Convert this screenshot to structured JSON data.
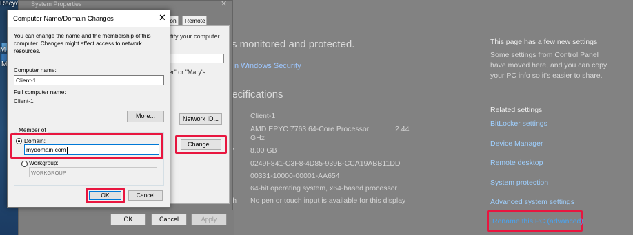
{
  "desktop": {
    "recycle_label": "Recycle",
    "icon_label_m": "M",
    "icon_label_m2": "M"
  },
  "settings": {
    "protection_heading": "s monitored and protected.",
    "windows_security_link": "n Windows Security",
    "specs_heading": "pecifications",
    "spec_fragment_memory": "M",
    "spec_fragment_pen": "ch",
    "specs": [
      {
        "value": "Client-1"
      },
      {
        "value": "AMD EPYC 7763 64-Core Processor",
        "extra": "2.44",
        "extra2": "GHz"
      },
      {
        "value": "8.00 GB"
      },
      {
        "value": "0249F841-C3F8-4D85-939B-CCA19ABB11DD"
      },
      {
        "value": "00331-10000-00001-AA654"
      },
      {
        "value": "64-bit operating system, x64-based processor"
      },
      {
        "value": "No pen or touch input is available for this display"
      }
    ],
    "new_settings_title": "This page has a few new settings",
    "new_settings_text": "Some settings from Control Panel have moved here, and you can copy your PC info so it's easier to share.",
    "related_title": "Related settings",
    "related_links": [
      "BitLocker settings",
      "Device Manager",
      "Remote desktop",
      "System protection",
      "Advanced system settings"
    ],
    "rename_link": "Rename this PC (advanced)",
    "highlight_color": "#e8163f"
  },
  "system_properties": {
    "title": "System Properties",
    "close_glyph": "✕",
    "tab_a": "tion",
    "tab_remote": "Remote",
    "text_identify": "ntify your computer",
    "text_or": "ter\" or \"Mary's",
    "network_id_button": "Network ID...",
    "change_button": "Change...",
    "ok_button": "OK",
    "cancel_button": "Cancel",
    "apply_button": "Apply"
  },
  "dialog": {
    "title": "Computer Name/Domain Changes",
    "close_glyph": "✕",
    "description": "You can change the name and the membership of this computer. Changes might affect access to network resources.",
    "computer_name_label": "Computer name:",
    "computer_name_value": "Client-1",
    "full_name_label": "Full computer name:",
    "full_name_value": "Client-1",
    "more_button": "More...",
    "member_of_label": "Member of",
    "domain_label": "Domain:",
    "domain_value": "mydomain.com",
    "workgroup_label": "Workgroup:",
    "workgroup_value": "WORKGROUP",
    "ok_button": "OK",
    "cancel_button": "Cancel"
  }
}
